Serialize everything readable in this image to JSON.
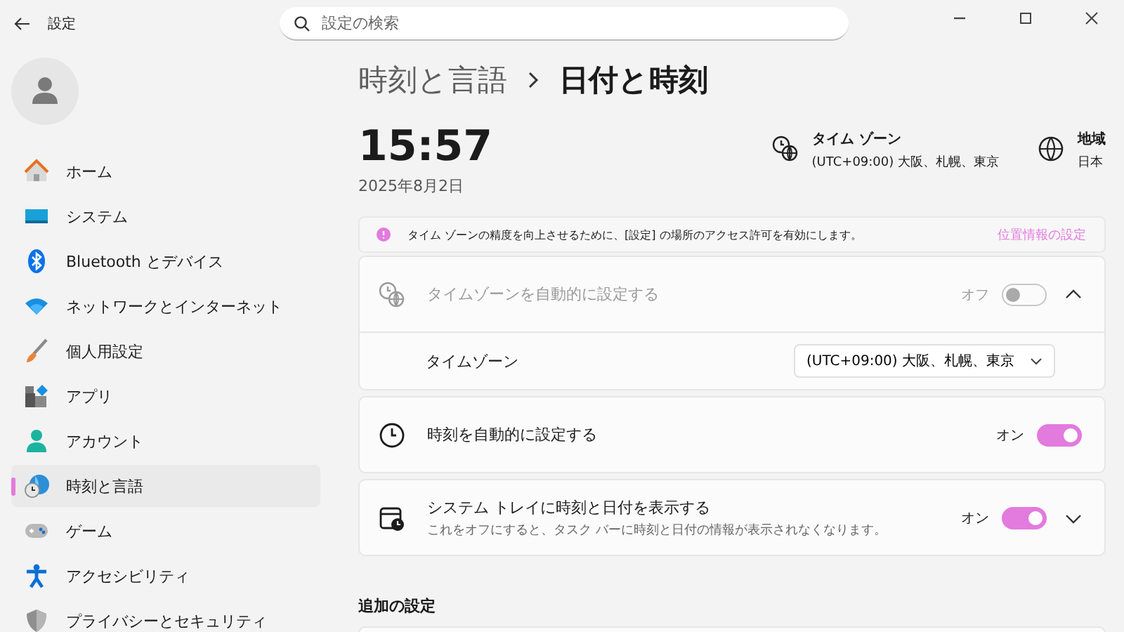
{
  "window": {
    "title": "設定"
  },
  "search": {
    "placeholder": "設定の検索"
  },
  "sidebar": {
    "items": [
      {
        "label": "ホーム",
        "kind": "home",
        "selected": false
      },
      {
        "label": "システム",
        "kind": "system",
        "selected": false
      },
      {
        "label": "Bluetooth とデバイス",
        "kind": "bluetooth",
        "selected": false
      },
      {
        "label": "ネットワークとインターネット",
        "kind": "network",
        "selected": false
      },
      {
        "label": "個人用設定",
        "kind": "brush",
        "selected": false
      },
      {
        "label": "アプリ",
        "kind": "apps",
        "selected": false
      },
      {
        "label": "アカウント",
        "kind": "account",
        "selected": false
      },
      {
        "label": "時刻と言語",
        "kind": "time",
        "selected": true
      },
      {
        "label": "ゲーム",
        "kind": "game",
        "selected": false
      },
      {
        "label": "アクセシビリティ",
        "kind": "accessibility",
        "selected": false
      },
      {
        "label": "プライバシーとセキュリティ",
        "kind": "privacy",
        "selected": false
      }
    ]
  },
  "breadcrumb": [
    "時刻と言語",
    "日付と時刻"
  ],
  "clock": {
    "time": "15:57",
    "date": "2025年8月2日"
  },
  "summary": [
    {
      "kind": "timezone",
      "title": "タイム ゾーン",
      "value": "(UTC+09:00) 大阪、札幌、東京"
    },
    {
      "kind": "region",
      "title": "地域",
      "value": "日本"
    }
  ],
  "notice": {
    "text": "タイム ゾーンの精度を向上させるために、[設定] の場所のアクセス許可を有効にします。",
    "link": "位置情報の設定"
  },
  "settings": [
    {
      "kind": "toggle",
      "label": "タイムゾーンを自動的に設定する",
      "state_label": "オフ",
      "on": false,
      "disabled": true,
      "expanded": true,
      "children": [
        {
          "kind": "dropdown",
          "label": "タイムゾーン",
          "value": "(UTC+09:00) 大阪、札幌、東京"
        }
      ]
    },
    {
      "kind": "toggle",
      "label": "時刻を自動的に設定する",
      "state_label": "オン",
      "on": true,
      "disabled": false
    },
    {
      "kind": "toggle",
      "label": "システム トレイに時刻と日付を表示する",
      "description": "これをオフにすると、タスク バーに時刻と日付の情報が表示されなくなります。",
      "state_label": "オン",
      "on": true,
      "disabled": false,
      "expanded": false
    }
  ],
  "additional": {
    "heading": "追加の設定"
  }
}
